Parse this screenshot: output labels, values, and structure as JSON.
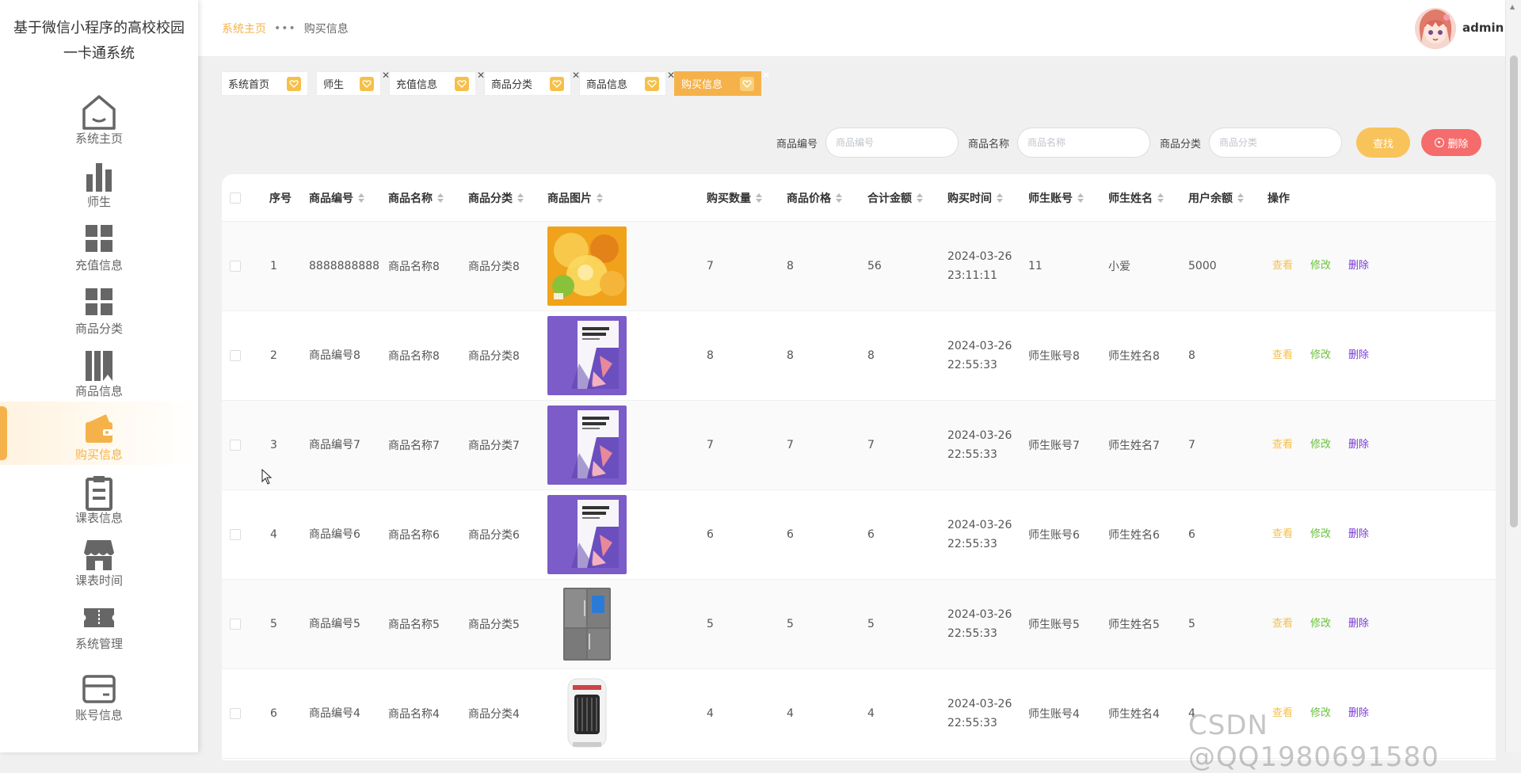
{
  "app": {
    "title": "基于微信小程序的高校校园一卡通系统"
  },
  "sidebar": {
    "items": [
      {
        "label": "系统主页",
        "icon": "home-icon"
      },
      {
        "label": "师生",
        "icon": "bar-chart-icon"
      },
      {
        "label": "充值信息",
        "icon": "grid-icon"
      },
      {
        "label": "商品分类",
        "icon": "grid-icon"
      },
      {
        "label": "商品信息",
        "icon": "book-icon"
      },
      {
        "label": "购买信息",
        "icon": "wallet-icon",
        "active": true
      },
      {
        "label": "课表信息",
        "icon": "clipboard-icon"
      },
      {
        "label": "课表时间",
        "icon": "store-icon"
      },
      {
        "label": "系统管理",
        "icon": "ticket-icon"
      },
      {
        "label": "账号信息",
        "icon": "card-icon"
      }
    ]
  },
  "header": {
    "breadcrumb": {
      "home": "系统主页",
      "separator": "•••",
      "current": "购买信息"
    },
    "user": "admin"
  },
  "tags": [
    {
      "label": "系统首页",
      "closable": false
    },
    {
      "label": "师生",
      "closable": true
    },
    {
      "label": "充值信息",
      "closable": true
    },
    {
      "label": "商品分类",
      "closable": true
    },
    {
      "label": "商品信息",
      "closable": true
    },
    {
      "label": "购买信息",
      "closable": true,
      "active": true
    }
  ],
  "search": {
    "fields": [
      {
        "label": "商品编号",
        "placeholder": "商品编号"
      },
      {
        "label": "商品名称",
        "placeholder": "商品名称"
      },
      {
        "label": "商品分类",
        "placeholder": "商品分类"
      }
    ],
    "search_label": "查找",
    "delete_label": "删除"
  },
  "table": {
    "columns": [
      "序号",
      "商品编号",
      "商品名称",
      "商品分类",
      "商品图片",
      "购买数量",
      "商品价格",
      "合计金额",
      "购买时间",
      "师生账号",
      "师生姓名",
      "用户余额",
      "操作"
    ],
    "sortable": [
      false,
      true,
      true,
      true,
      true,
      true,
      true,
      true,
      true,
      true,
      true,
      true,
      false
    ],
    "actions": {
      "view": "查看",
      "edit": "修改",
      "delete": "删除"
    },
    "rows": [
      {
        "no": "1",
        "code": "8888888888",
        "name": "商品名称8",
        "category": "商品分类8",
        "image": "fruit-tea",
        "qty": "7",
        "price": "8",
        "total": "56",
        "date": "2024-03-26",
        "time": "23:11:11",
        "account": "11",
        "person": "小爱",
        "balance": "5000"
      },
      {
        "no": "2",
        "code": "商品编号8",
        "name": "商品名称8",
        "category": "商品分类8",
        "image": "purple-book",
        "qty": "8",
        "price": "8",
        "total": "8",
        "date": "2024-03-26",
        "time": "22:55:33",
        "account": "师生账号8",
        "person": "师生姓名8",
        "balance": "8"
      },
      {
        "no": "3",
        "code": "商品编号7",
        "name": "商品名称7",
        "category": "商品分类7",
        "image": "purple-book",
        "qty": "7",
        "price": "7",
        "total": "7",
        "date": "2024-03-26",
        "time": "22:55:33",
        "account": "师生账号7",
        "person": "师生姓名7",
        "balance": "7"
      },
      {
        "no": "4",
        "code": "商品编号6",
        "name": "商品名称6",
        "category": "商品分类6",
        "image": "purple-book",
        "qty": "6",
        "price": "6",
        "total": "6",
        "date": "2024-03-26",
        "time": "22:55:33",
        "account": "师生账号6",
        "person": "师生姓名6",
        "balance": "6"
      },
      {
        "no": "5",
        "code": "商品编号5",
        "name": "商品名称5",
        "category": "商品分类5",
        "image": "fridge",
        "qty": "5",
        "price": "5",
        "total": "5",
        "date": "2024-03-26",
        "time": "22:55:33",
        "account": "师生账号5",
        "person": "师生姓名5",
        "balance": "5"
      },
      {
        "no": "6",
        "code": "商品编号4",
        "name": "商品名称4",
        "category": "商品分类4",
        "image": "heater",
        "qty": "4",
        "price": "4",
        "total": "4",
        "date": "2024-03-26",
        "time": "22:55:33",
        "account": "师生账号4",
        "person": "师生姓名4",
        "balance": "4"
      }
    ]
  },
  "watermark": "CSDN @QQ1980691580",
  "colors": {
    "accent": "#f5b24a",
    "danger": "#f56c6c",
    "edit": "#67c23a",
    "delete_link": "#7a3ad6"
  }
}
